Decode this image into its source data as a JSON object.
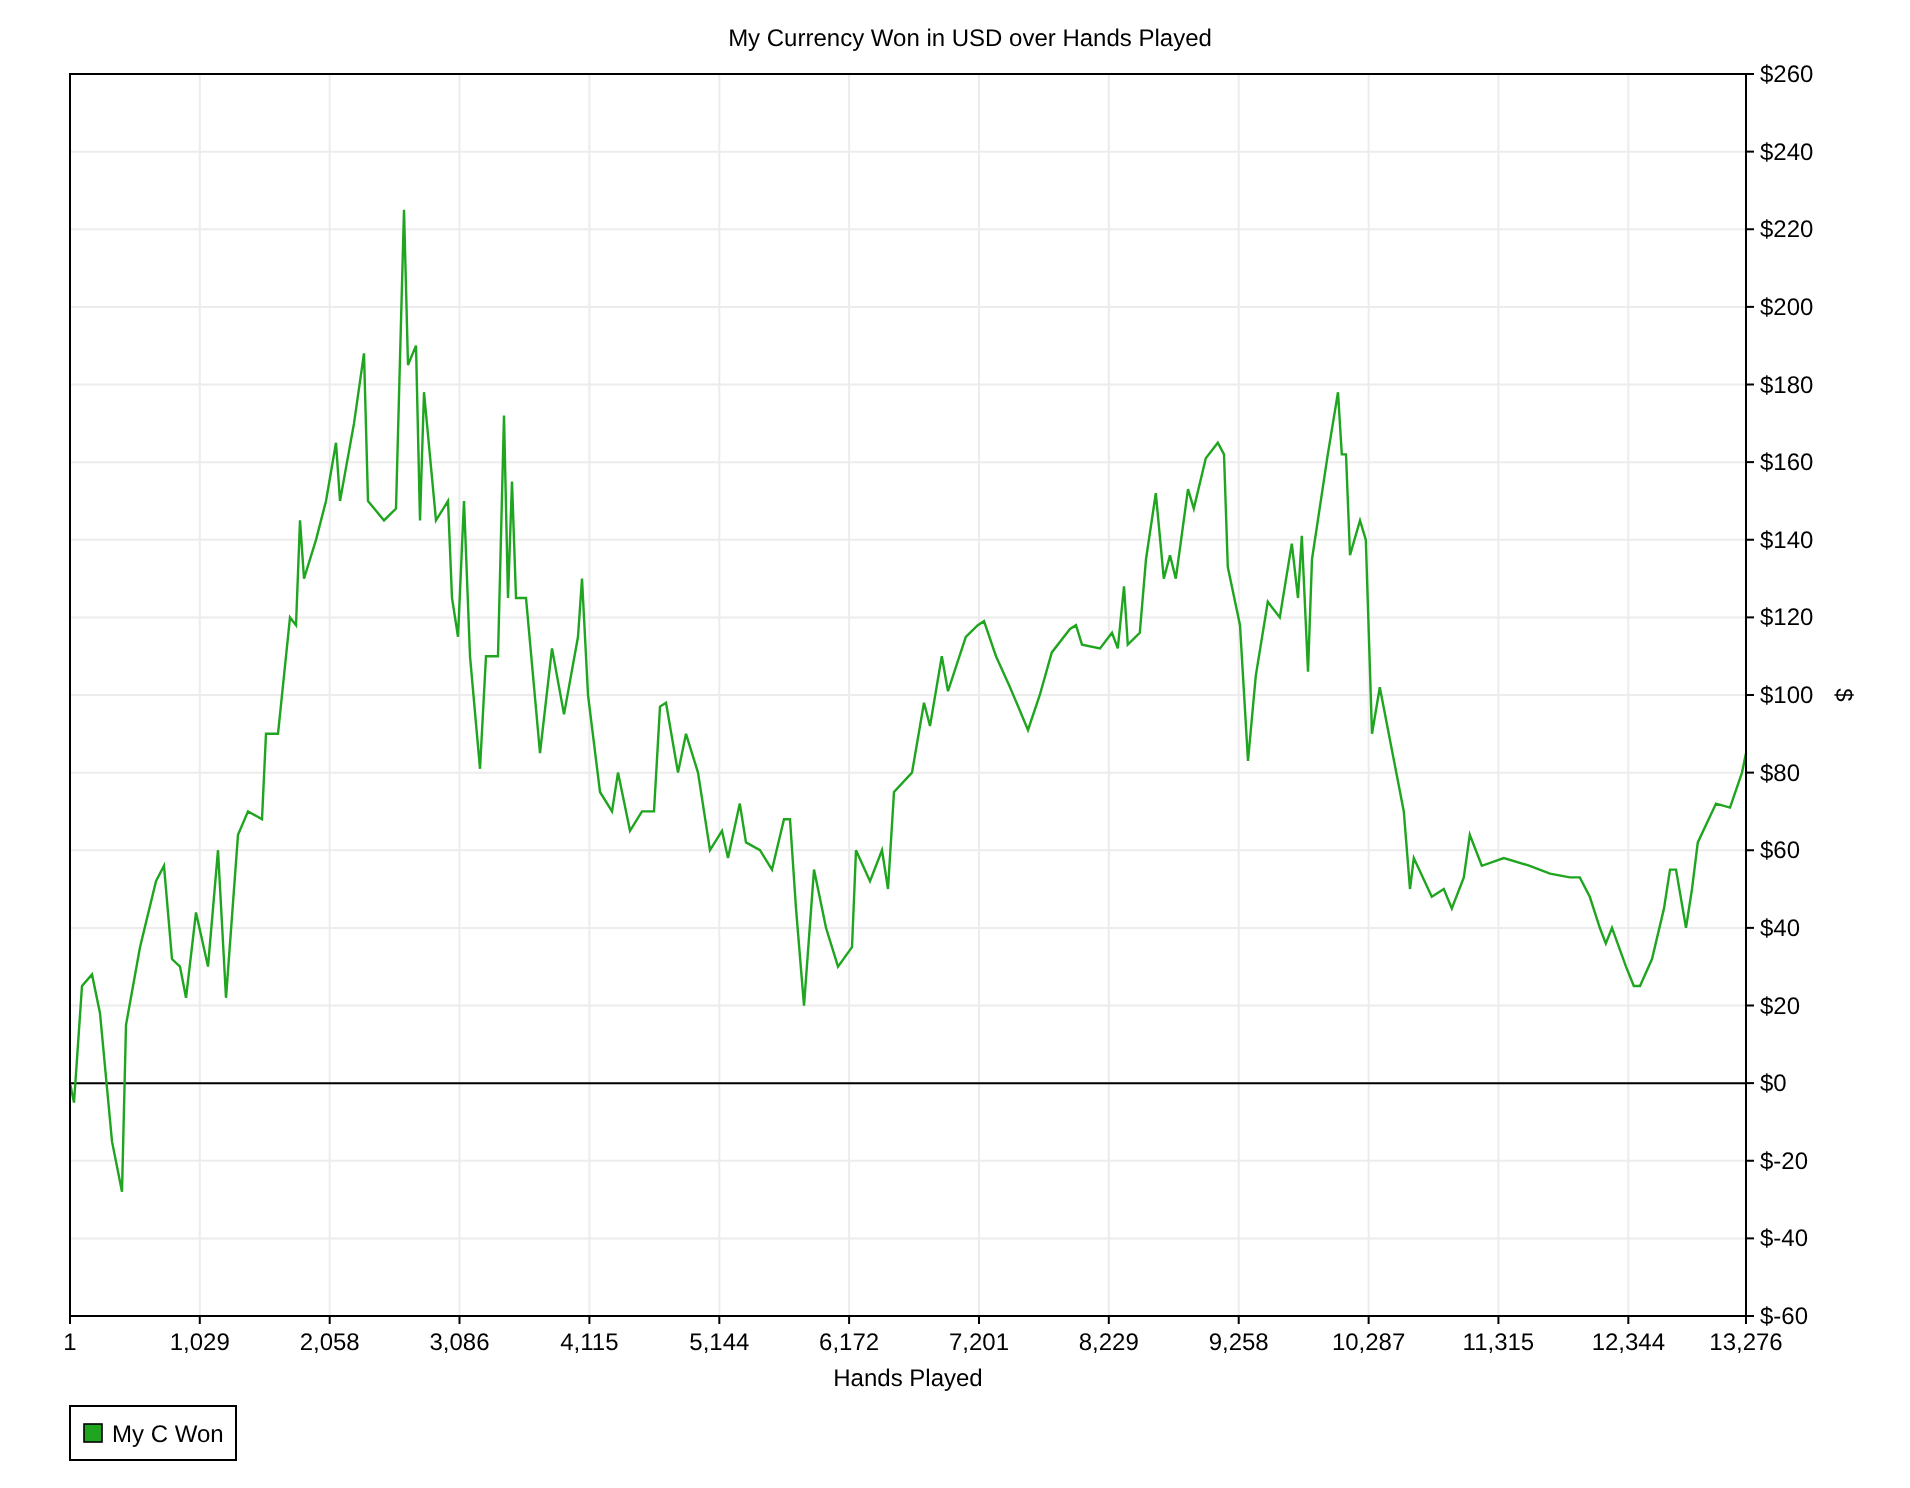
{
  "chart": {
    "chart_data": {
      "type": "line",
      "title": "My Currency Won in USD over Hands Played",
      "xlabel": "Hands Played",
      "ylabel": "$",
      "grid": true,
      "xlim": [
        1,
        13276
      ],
      "ylim": [
        -60,
        260
      ],
      "xticks": [
        {
          "value": 1,
          "label": "1"
        },
        {
          "value": 1029,
          "label": "1,029"
        },
        {
          "value": 2058,
          "label": "2,058"
        },
        {
          "value": 3086,
          "label": "3,086"
        },
        {
          "value": 4115,
          "label": "4,115"
        },
        {
          "value": 5144,
          "label": "5,144"
        },
        {
          "value": 6172,
          "label": "6,172"
        },
        {
          "value": 7201,
          "label": "7,201"
        },
        {
          "value": 8229,
          "label": "8,229"
        },
        {
          "value": 9258,
          "label": "9,258"
        },
        {
          "value": 10287,
          "label": "10,287"
        },
        {
          "value": 11315,
          "label": "11,315"
        },
        {
          "value": 12344,
          "label": "12,344"
        },
        {
          "value": 13276,
          "label": "13,276"
        }
      ],
      "yticks": [
        {
          "value": 260,
          "label": "$260"
        },
        {
          "value": 240,
          "label": "$240"
        },
        {
          "value": 220,
          "label": "$220"
        },
        {
          "value": 200,
          "label": "$200"
        },
        {
          "value": 180,
          "label": "$180"
        },
        {
          "value": 160,
          "label": "$160"
        },
        {
          "value": 140,
          "label": "$140"
        },
        {
          "value": 120,
          "label": "$120"
        },
        {
          "value": 100,
          "label": "$100"
        },
        {
          "value": 80,
          "label": "$80"
        },
        {
          "value": 60,
          "label": "$60"
        },
        {
          "value": 40,
          "label": "$40"
        },
        {
          "value": 20,
          "label": "$20"
        },
        {
          "value": 0,
          "label": "$0"
        },
        {
          "value": -20,
          "label": "$-20"
        },
        {
          "value": -40,
          "label": "$-40"
        },
        {
          "value": -60,
          "label": "$-60"
        }
      ],
      "x": [
        1,
        33,
        96,
        175,
        239,
        334,
        413,
        445,
        555,
        682,
        745,
        809,
        872,
        920,
        999,
        1094,
        1173,
        1237,
        1332,
        1411,
        1522,
        1553,
        1648,
        1743,
        1791,
        1823,
        1854,
        1949,
        2029,
        2108,
        2140,
        2250,
        2329,
        2361,
        2488,
        2583,
        2646,
        2678,
        2741,
        2773,
        2805,
        2900,
        2995,
        3026,
        3074,
        3121,
        3169,
        3248,
        3296,
        3391,
        3438,
        3470,
        3502,
        3533,
        3613,
        3724,
        3818,
        3914,
        4024,
        4056,
        4104,
        4199,
        4294,
        4341,
        4436,
        4531,
        4626,
        4674,
        4721,
        4816,
        4880,
        4975,
        5070,
        5165,
        5212,
        5307,
        5355,
        5466,
        5561,
        5656,
        5704,
        5751,
        5814,
        5894,
        5989,
        6084,
        6195,
        6226,
        6337,
        6432,
        6480,
        6527,
        6670,
        6765,
        6813,
        6907,
        6955,
        7097,
        7192,
        7240,
        7335,
        7446,
        7589,
        7683,
        7778,
        7921,
        7969,
        8016,
        8159,
        8254,
        8301,
        8349,
        8380,
        8475,
        8523,
        8602,
        8665,
        8713,
        8760,
        8856,
        8903,
        8998,
        9093,
        9141,
        9172,
        9268,
        9331,
        9394,
        9489,
        9584,
        9679,
        9727,
        9758,
        9806,
        9838,
        9964,
        10044,
        10075,
        10107,
        10139,
        10218,
        10265,
        10313,
        10376,
        10471,
        10566,
        10614,
        10645,
        10788,
        10883,
        10946,
        11041,
        11089,
        11184,
        11358,
        11564,
        11723,
        11881,
        11960,
        12039,
        12118,
        12166,
        12214,
        12325,
        12388,
        12436,
        12531,
        12626,
        12674,
        12721,
        12800,
        12848,
        12895,
        13038,
        13149,
        13244,
        13276
      ],
      "series": [
        {
          "name": "My C Won",
          "color": "#1fa51f",
          "values": [
            0,
            -5,
            25,
            28,
            18,
            -15,
            -28,
            15,
            35,
            52,
            56,
            32,
            30,
            22,
            44,
            30,
            60,
            22,
            64,
            70,
            68,
            90,
            90,
            120,
            118,
            145,
            130,
            140,
            150,
            165,
            150,
            170,
            188,
            150,
            145,
            148,
            225,
            185,
            190,
            145,
            178,
            145,
            150,
            125,
            115,
            150,
            110,
            81,
            110,
            110,
            172,
            125,
            155,
            125,
            125,
            85,
            112,
            95,
            115,
            130,
            100,
            75,
            70,
            80,
            65,
            70,
            70,
            97,
            98,
            80,
            90,
            80,
            60,
            65,
            58,
            72,
            62,
            60,
            55,
            68,
            68,
            45,
            20,
            55,
            40,
            30,
            35,
            60,
            52,
            60,
            50,
            75,
            80,
            98,
            92,
            110,
            101,
            115,
            118,
            119,
            110,
            102,
            91,
            100,
            111,
            117,
            118,
            113,
            112,
            116,
            112,
            128,
            113,
            116,
            135,
            152,
            130,
            136,
            130,
            153,
            148,
            161,
            165,
            162,
            133,
            118,
            83,
            105,
            124,
            120,
            139,
            125,
            141,
            106,
            135,
            162,
            178,
            162,
            162,
            136,
            145,
            140,
            90,
            102,
            86,
            70,
            50,
            58,
            48,
            50,
            45,
            53,
            64,
            56,
            58,
            56,
            54,
            53,
            53,
            48,
            40,
            36,
            40,
            30,
            25,
            25,
            32,
            45,
            55,
            55,
            40,
            50,
            62,
            72,
            71,
            80,
            85
          ]
        }
      ]
    }
  }
}
